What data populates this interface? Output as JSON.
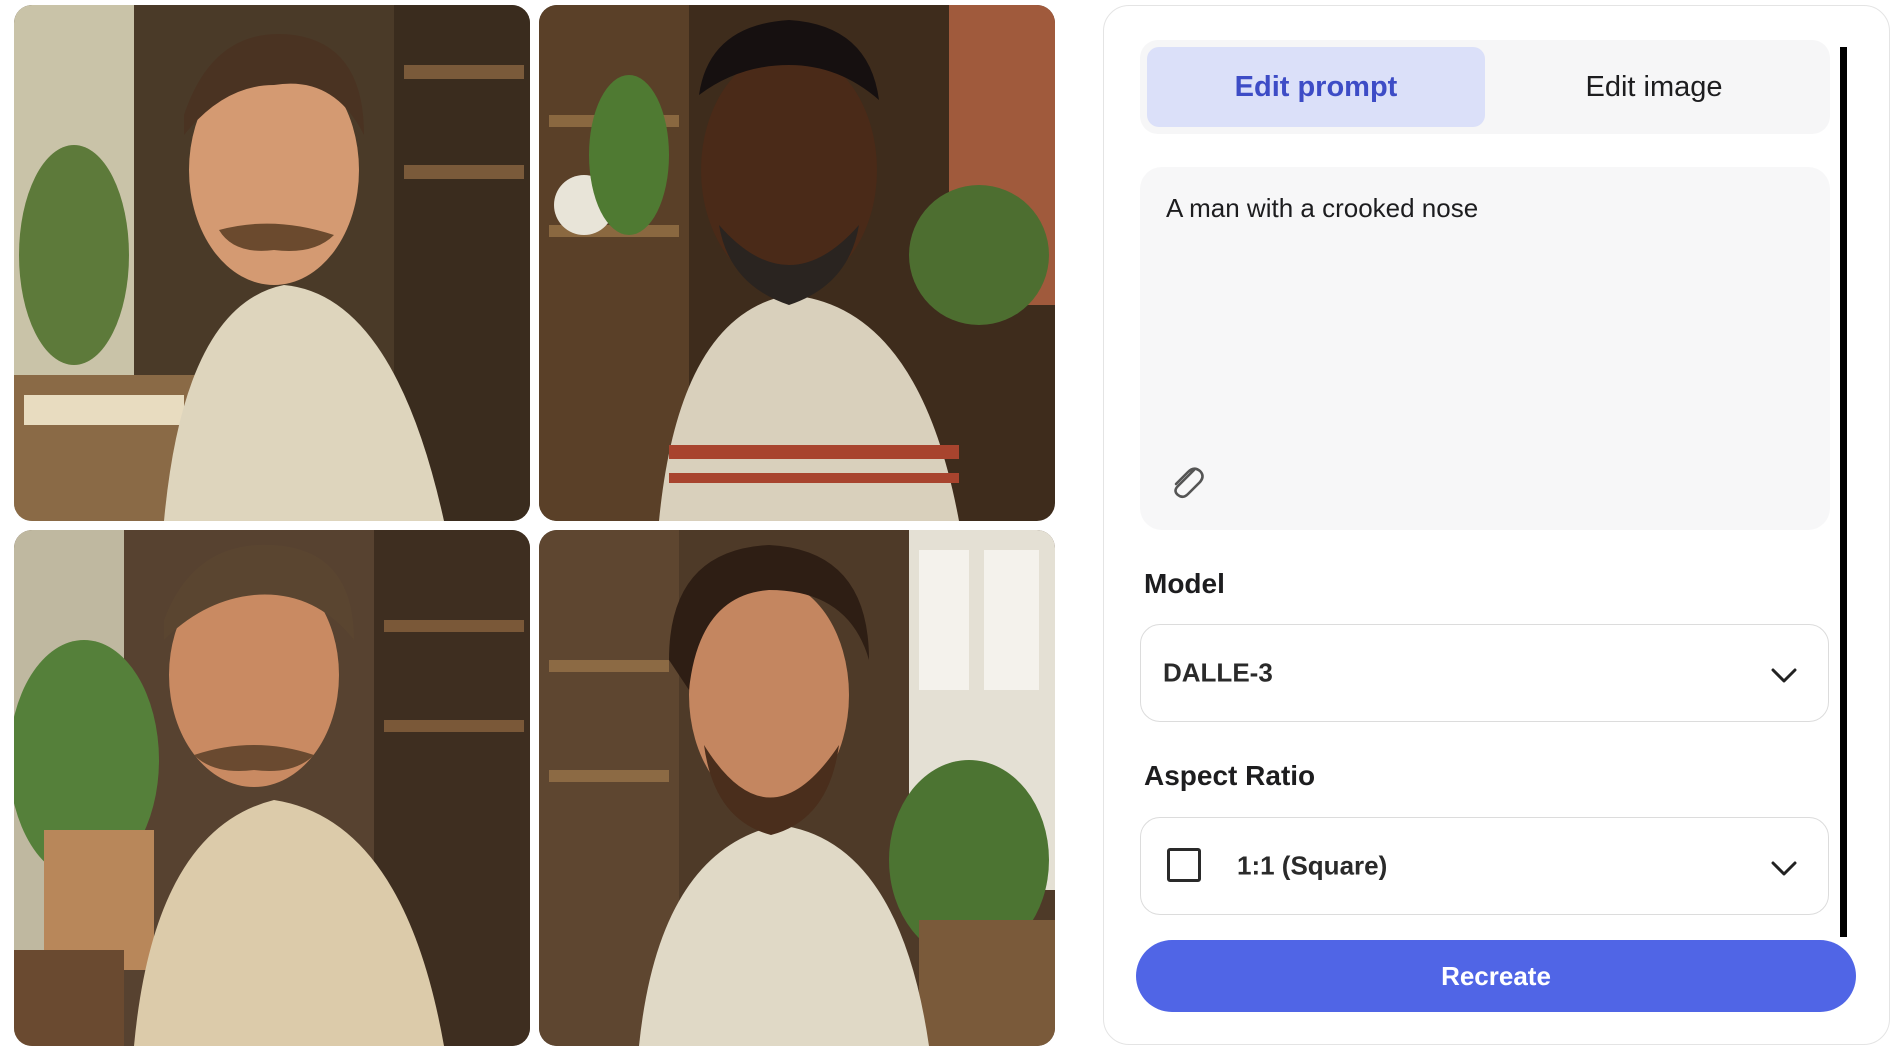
{
  "gallery": {
    "images": [
      {
        "name": "generated-image-1"
      },
      {
        "name": "generated-image-2"
      },
      {
        "name": "generated-image-3"
      },
      {
        "name": "generated-image-4"
      }
    ]
  },
  "tabs": {
    "edit_prompt": "Edit prompt",
    "edit_image": "Edit image",
    "active": "edit_prompt"
  },
  "prompt": {
    "text": "A man with a crooked nose",
    "attach_icon": "paperclip-icon"
  },
  "model": {
    "label": "Model",
    "value": "DALLE-3"
  },
  "aspect_ratio": {
    "label": "Aspect Ratio",
    "value": "1:1 (Square)",
    "icon": "square-icon"
  },
  "actions": {
    "recreate": "Recreate"
  },
  "colors": {
    "accent": "#5065e6",
    "tab_active_bg": "#dbe0f9",
    "tab_active_text": "#3d4cc6"
  }
}
